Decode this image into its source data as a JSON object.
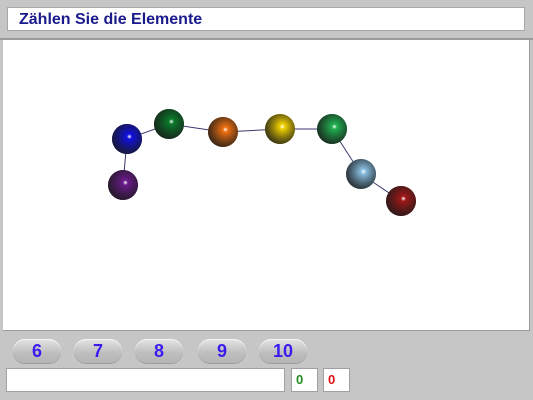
{
  "title": "Zählen Sie die Elemente",
  "answers": [
    "6",
    "7",
    "8",
    "9",
    "10"
  ],
  "status_text": "",
  "score": {
    "correct": "0",
    "wrong": "0"
  },
  "colors": {
    "accent_text": "#3a1cf0",
    "title_text": "#1a1a8c",
    "correct": "#1e8c1e",
    "wrong": "#e01010"
  },
  "balls": [
    {
      "name": "purple-ball",
      "color": "#6a1a8a"
    },
    {
      "name": "blue-ball",
      "color": "#1010e0"
    },
    {
      "name": "dark-green-ball",
      "color": "#0a7a2a"
    },
    {
      "name": "orange-ball",
      "color": "#f07010"
    },
    {
      "name": "yellow-ball",
      "color": "#f0d000"
    },
    {
      "name": "green-ball",
      "color": "#20b050"
    },
    {
      "name": "light-blue-ball",
      "color": "#88bde0"
    },
    {
      "name": "dark-red-ball",
      "color": "#a01818"
    }
  ]
}
